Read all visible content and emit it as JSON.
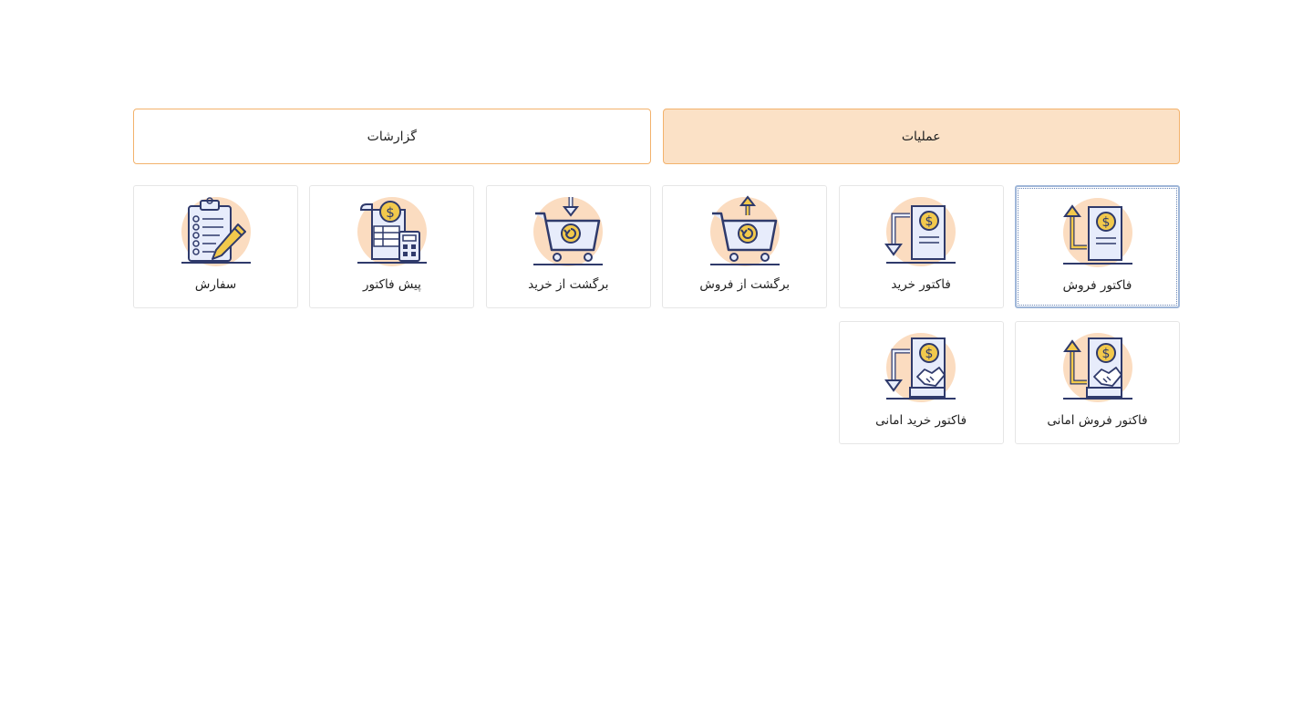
{
  "tabs": [
    {
      "label": "عملیات",
      "active": true
    },
    {
      "label": "گزارشات",
      "active": false
    }
  ],
  "tiles": [
    {
      "label": "فاکتور فروش",
      "icon": "sales-invoice-icon"
    },
    {
      "label": "فاکتور خرید",
      "icon": "purchase-invoice-icon"
    },
    {
      "label": "برگشت از فروش",
      "icon": "sales-return-icon"
    },
    {
      "label": "برگشت از خرید",
      "icon": "purchase-return-icon"
    },
    {
      "label": "پیش فاکتور",
      "icon": "proforma-invoice-icon"
    },
    {
      "label": "سفارش",
      "icon": "order-icon"
    },
    {
      "label": "فاکتور فروش امانی",
      "icon": "consignment-sales-invoice-icon"
    },
    {
      "label": "فاکتور خرید امانی",
      "icon": "consignment-purchase-invoice-icon"
    }
  ],
  "colors": {
    "accent_border": "#f3b26c",
    "active_tab_bg": "#fbe1c6",
    "icon_circle": "#fbdcc0",
    "icon_stroke": "#2f3a6b",
    "icon_gold": "#f2c94c",
    "icon_paper": "#e7ecfb"
  }
}
